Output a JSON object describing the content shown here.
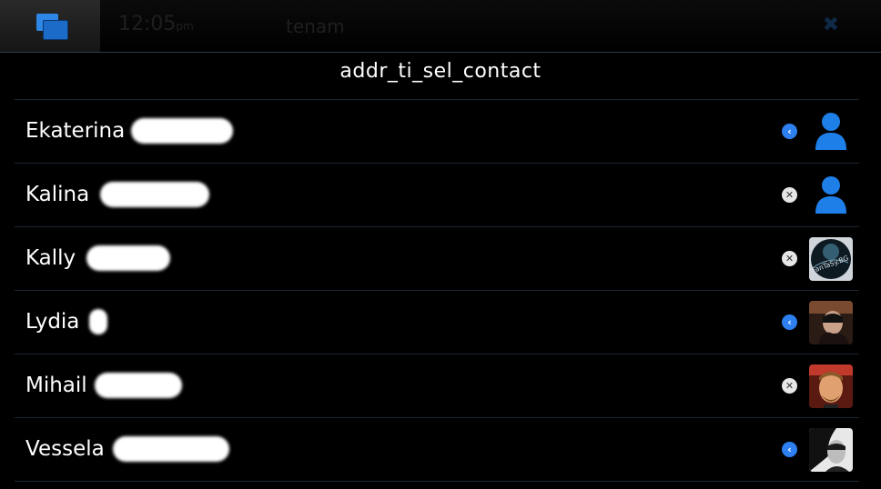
{
  "statusbar": {
    "time": "12:05",
    "ampm": "pm",
    "name": "tenam",
    "close_glyph": "✖"
  },
  "title": "addr_ti_sel_contact",
  "contacts": [
    {
      "name": "Ekaterina",
      "status": "blue",
      "status_glyph": "‹",
      "avatar": "default-person-icon"
    },
    {
      "name": "Kalina",
      "status": "gray",
      "status_glyph": "✕",
      "avatar": "default-person-icon"
    },
    {
      "name": "Kally",
      "status": "gray",
      "status_glyph": "✕",
      "avatar": "photo",
      "avatar_text": "FanTaSy.BG"
    },
    {
      "name": "Lydia",
      "status": "blue",
      "status_glyph": "‹",
      "avatar": "photo"
    },
    {
      "name": "Mihail",
      "status": "gray",
      "status_glyph": "✕",
      "avatar": "photo"
    },
    {
      "name": "Vessela",
      "status": "blue",
      "status_glyph": "‹",
      "avatar": "photo"
    }
  ],
  "colors": {
    "accent": "#2e86e6",
    "background": "#000000",
    "separator": "#1c2632"
  }
}
